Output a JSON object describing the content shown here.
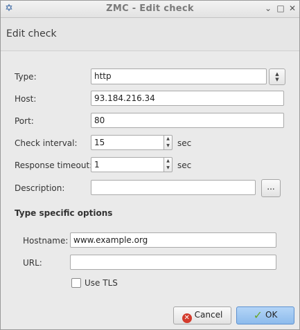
{
  "window": {
    "title": "ZMC - Edit check",
    "controls": {
      "minimize": "⌄",
      "maximize": "□",
      "close": "✕"
    }
  },
  "header": {
    "title": "Edit check"
  },
  "form": {
    "type": {
      "label": "Type:",
      "value": "http"
    },
    "host": {
      "label": "Host:",
      "value": "93.184.216.34"
    },
    "port": {
      "label": "Port:",
      "value": "80"
    },
    "check_interval": {
      "label": "Check interval:",
      "value": "15",
      "unit": "sec"
    },
    "response_timeout": {
      "label": "Response timeout:",
      "value": "1",
      "unit": "sec"
    },
    "description": {
      "label": "Description:",
      "value": "",
      "browse_label": "..."
    }
  },
  "type_specific": {
    "title": "Type specific options",
    "hostname": {
      "label": "Hostname:",
      "value": "www.example.org"
    },
    "url": {
      "label": "URL:",
      "value": ""
    },
    "use_tls": {
      "label": "Use TLS",
      "checked": false
    }
  },
  "buttons": {
    "cancel": "Cancel",
    "ok": "OK"
  },
  "colors": {
    "ok_button": "#9ec5f0",
    "accent": "#2f5f9f"
  }
}
